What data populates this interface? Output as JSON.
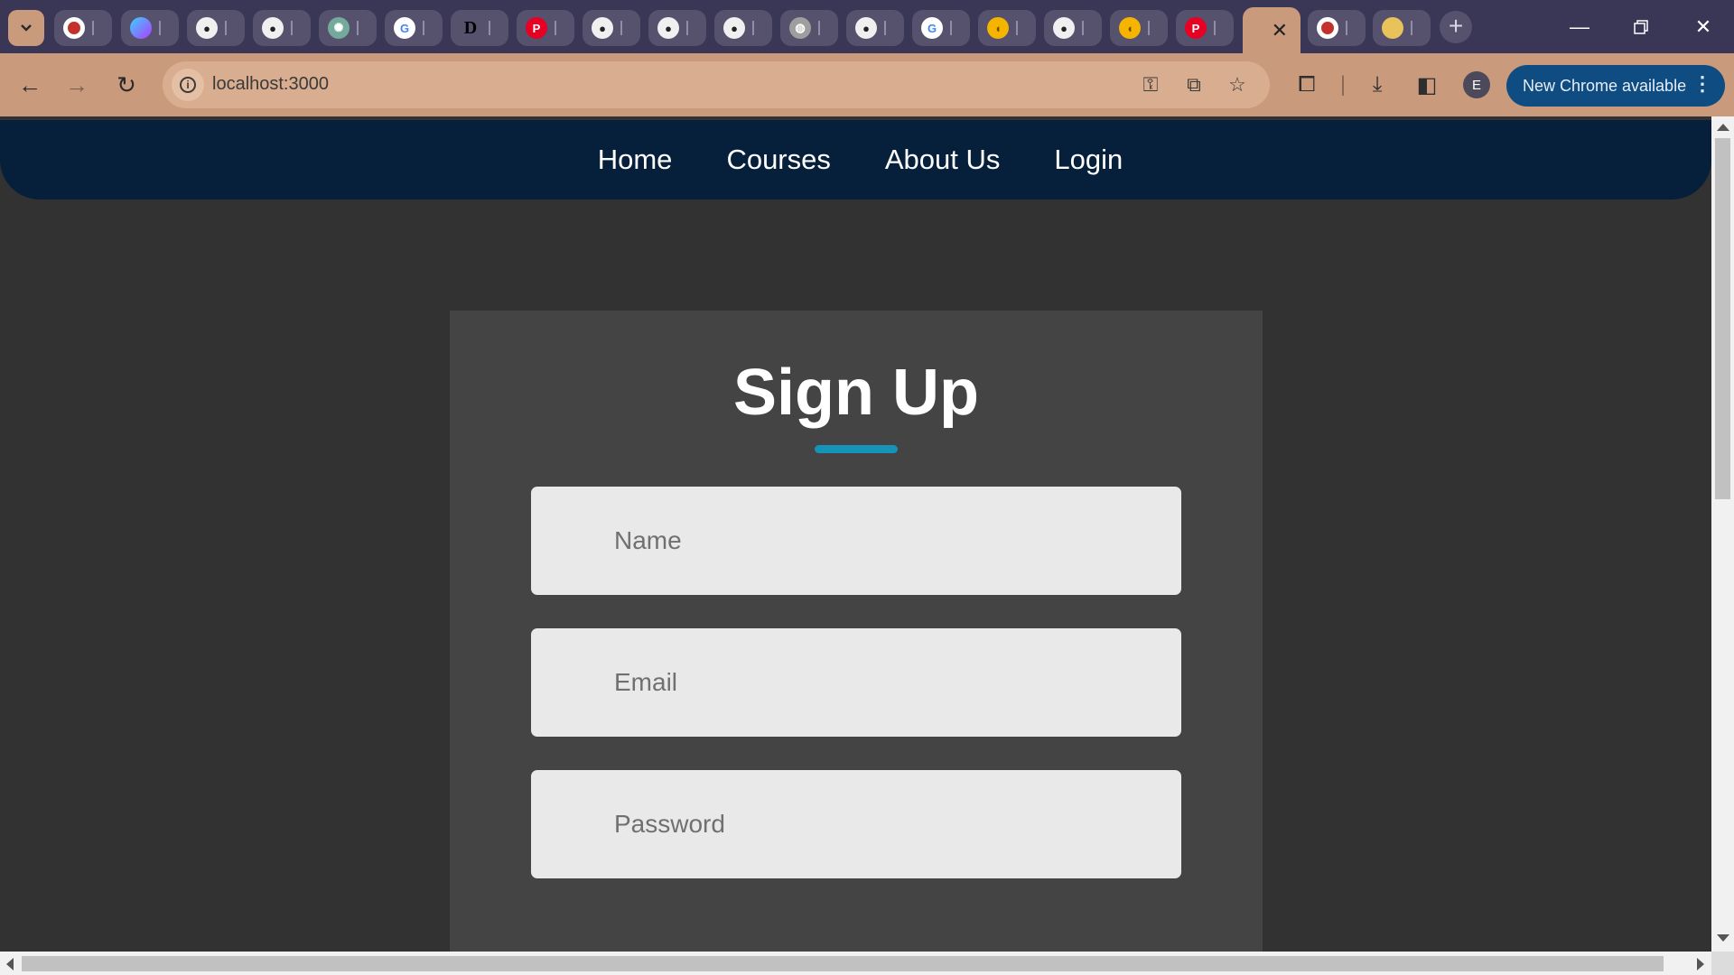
{
  "browser": {
    "address": "localhost:3000",
    "update_button": "New Chrome available",
    "profile_initial": "E",
    "tabs": [
      {
        "icon": "youtube-icon",
        "color": "#c4302b"
      },
      {
        "icon": "shield-icon",
        "color": "#7b4dff"
      },
      {
        "icon": "github-icon",
        "color": "#f0f0f0"
      },
      {
        "icon": "github-icon",
        "color": "#f0f0f0"
      },
      {
        "icon": "chatgpt-icon",
        "color": "#74aa9c"
      },
      {
        "icon": "google-icon",
        "color": "#4285f4"
      },
      {
        "icon": "dev-icon",
        "color": "#000000"
      },
      {
        "icon": "pinterest-icon",
        "color": "#e60023"
      },
      {
        "icon": "github-icon",
        "color": "#f0f0f0"
      },
      {
        "icon": "github-icon",
        "color": "#f0f0f0"
      },
      {
        "icon": "github-icon",
        "color": "#f0f0f0"
      },
      {
        "icon": "globe-icon",
        "color": "#9e9e9e"
      },
      {
        "icon": "github-icon",
        "color": "#f0f0f0"
      },
      {
        "icon": "google-icon",
        "color": "#4285f4"
      },
      {
        "icon": "duck-icon",
        "color": "#f4b400"
      },
      {
        "icon": "github-icon",
        "color": "#f0f0f0"
      },
      {
        "icon": "duck-icon",
        "color": "#f4b400"
      },
      {
        "icon": "pinterest-icon",
        "color": "#e60023"
      }
    ]
  },
  "site": {
    "nav": [
      "Home",
      "Courses",
      "About Us",
      "Login"
    ],
    "form": {
      "title": "Sign Up",
      "accent_color": "#1593b8",
      "name_placeholder": "Name",
      "email_placeholder": "Email",
      "password_placeholder": "Password"
    }
  }
}
